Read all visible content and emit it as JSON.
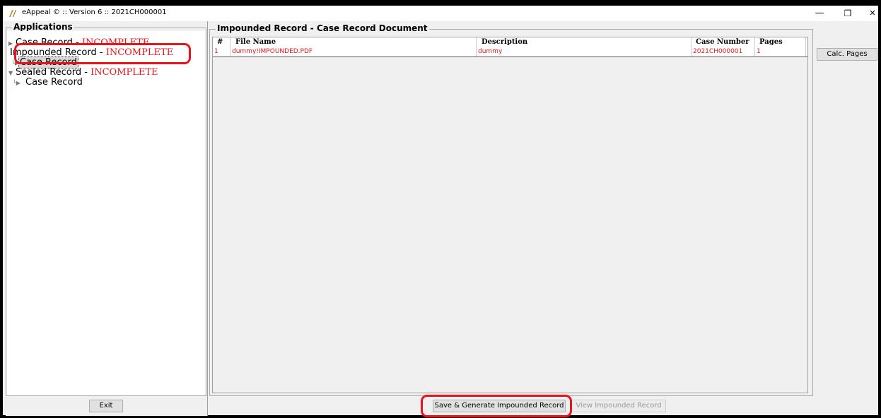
{
  "window": {
    "title": "eAppeal © :: Version 6 :: 2021CH000001",
    "minimize_glyph": "—",
    "restore_glyph": "❐",
    "close_glyph": "✕"
  },
  "sidebar": {
    "legend": "Applications",
    "tree": [
      {
        "label": "Case Record - ",
        "status": "INCOMPLETE",
        "expanded": false
      },
      {
        "label": "Impounded Record - ",
        "status": "INCOMPLETE",
        "expanded": true,
        "children": [
          {
            "label": "Case Record",
            "selected": true
          }
        ]
      },
      {
        "label": "Sealed Record - ",
        "status": "INCOMPLETE",
        "expanded": true,
        "children": [
          {
            "label": "Case Record",
            "selected": false
          }
        ]
      }
    ],
    "exit_label": "Exit"
  },
  "main": {
    "legend": "Impounded Record - Case Record Document",
    "columns": [
      "#",
      "File Name",
      "Description",
      "Case Number",
      "Pages"
    ],
    "rows": [
      {
        "num": "1",
        "file_name": "dummy!IMPOUNDED.PDF",
        "description": "dummy",
        "case_number": "2021CH000001",
        "pages": "1"
      }
    ],
    "calc_pages_label": "Calc. Pages",
    "save_generate_label": "Save & Generate Impounded Record",
    "view_label": "View Impounded Record"
  },
  "colors": {
    "incomplete": "#e8141b",
    "annotation": "#e8141b",
    "row_text": "#e8141b"
  }
}
